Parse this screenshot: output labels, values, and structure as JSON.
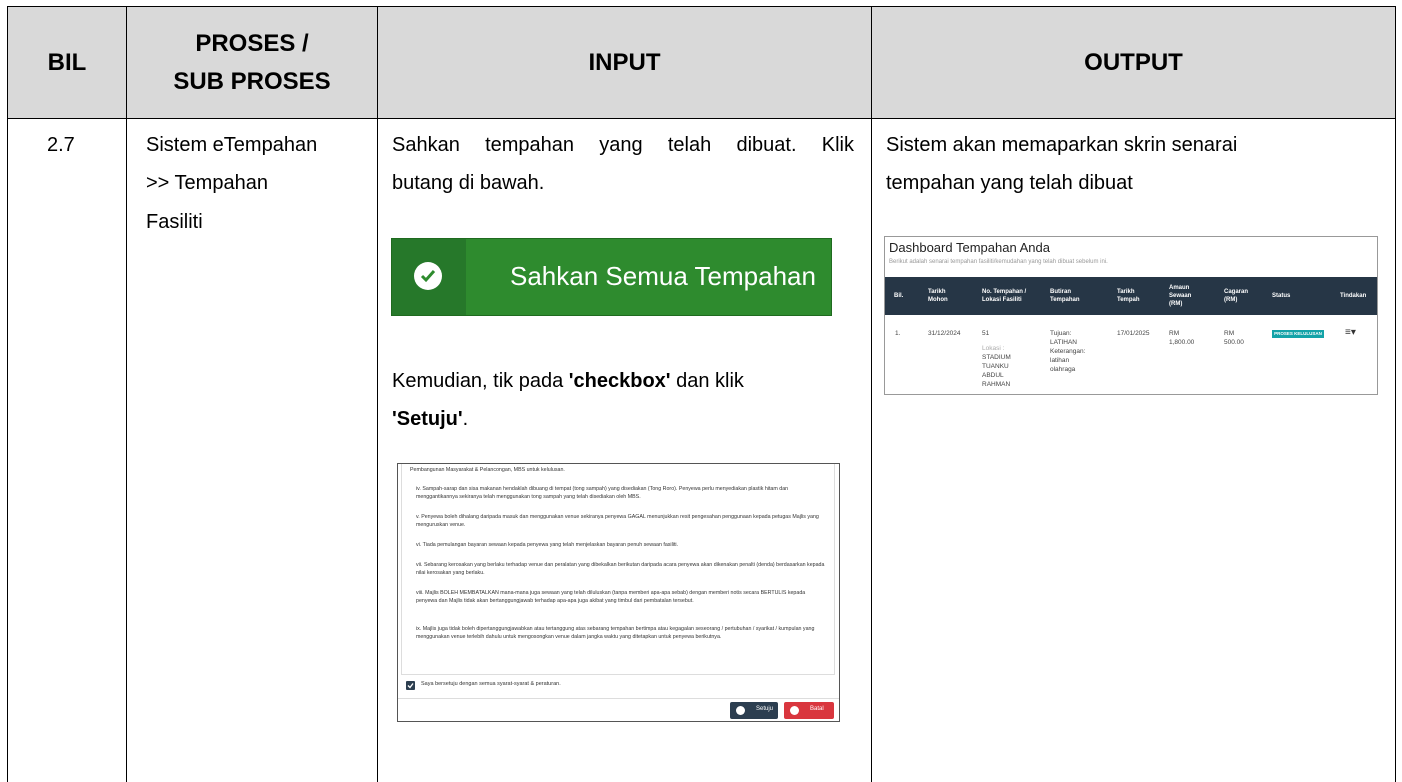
{
  "header": {
    "bil": "BIL",
    "proses_line1": "PROSES /",
    "proses_line2": "SUB PROSES",
    "input": "INPUT",
    "output": "OUTPUT"
  },
  "row": {
    "bil": "2.7",
    "proses_line1": "Sistem eTempahan",
    "proses_line2": ">> Tempahan",
    "proses_line3": "Fasiliti",
    "input_line1": "Sahkan tempahan yang telah dibuat. Klik",
    "input_line2": "butang di bawah.",
    "button_label": "Sahkan Semua Tempahan",
    "input_line3_pre": "Kemudian, tik pada ",
    "input_line3_bold": "'checkbox'",
    "input_line3_post": " dan klik",
    "input_line4_bold": "'Setuju'",
    "input_line4_post": ".",
    "output_line1": "Sistem akan memaparkan skrin senarai",
    "output_line2": "tempahan yang telah dibuat"
  },
  "dashboard": {
    "title": "Dashboard Tempahan Anda",
    "subtitle": "Berikut adalah senarai tempahan fasiliti/kemudahan yang telah dibuat sebelum ini.",
    "columns": {
      "bil": "Bil.",
      "tarikh_mohon": "Tarikh Mohon",
      "no_tempahan": "No. Tempahan / Lokasi Fasiliti",
      "butiran": "Butiran Tempahan",
      "tarikh_tempah": "Tarikh Tempah",
      "amaun": "Amaun Sewaan (RM)",
      "cagaran": "Cagaran (RM)",
      "status": "Status",
      "tindakan": "Tindakan"
    },
    "row": {
      "bil": "1.",
      "tarikh_mohon": "31/12/2024",
      "no": "51",
      "lokasi_label": "Lokasi :",
      "lokasi": "STADIUM TUANKU ABDUL RAHMAN",
      "tujuan": "Tujuan: LATIHAN",
      "keterangan": "Keterangan: latihan olahraga",
      "tarikh_tempah": "17/01/2025",
      "amaun": "RM 1,800.00",
      "cagaran": "RM 500.00",
      "status": "PROSES KELULUSAN",
      "tindakan": "≡▾"
    }
  },
  "agreement": {
    "p0": "Pembangunan Masyarakat & Pelancongan, MBS untuk kelulusan.",
    "p1": "iv. Sampah-sarap dan sisa makanan hendaklah dibuang di tempat (tong sampah) yang disediakan (Tong Roro). Penyewa perlu menyediakan plastik hitam dan menggantikannya sekiranya telah menggunakan tong sampah yang telah disediakan oleh MBS.",
    "p2": "v. Penyewa boleh dihalang daripada masuk dan menggunakan venue sekiranya penyewa GAGAL menunjukkan resit pengesahan penggunaan kepada petugas Majlis yang menguruskan venue.",
    "p3": "vi. Tiada pemulangan bayaran sewaan kepada penyewa yang telah menjelaskan bayaran penuh sewaan fasiliti.",
    "p4": "vii. Sebarang kerosakan yang berlaku terhadap venue dan peralatan yang dibekalkan berikutan daripada acara penyewa akan dikenakan penalti (denda) berdasarkan kepada nilai kerosakan yang berlaku.",
    "p5": "viii. Majlis BOLEH MEMBATALKAN mana-mana juga sewaan yang telah diluluskan (tanpa memberi apa-apa sebab) dengan memberi notis secara BERTULIS kepada penyewa dan Majlis tidak akan bertanggungjawab terhadap apa-apa juga akibat yang timbul dari pembatalan tersebut.",
    "p6": "ix. Majlis juga tidak boleh dipertanggungjawabkan atau tertanggung atas sebarang tempahan bertimpa atau kegagalan seseorang / pertubuhan / syarikat / kumpulan yang menggunakan venue terlebih dahulu untuk mengosongkan venue dalam jangka waktu yang ditetapkan untuk penyewa berikutnya.",
    "checkbox_label": "Saya bersetuju dengan semua syarat-syarat & peraturan.",
    "agree_button": "Setuju",
    "cancel_button": "Batal"
  }
}
